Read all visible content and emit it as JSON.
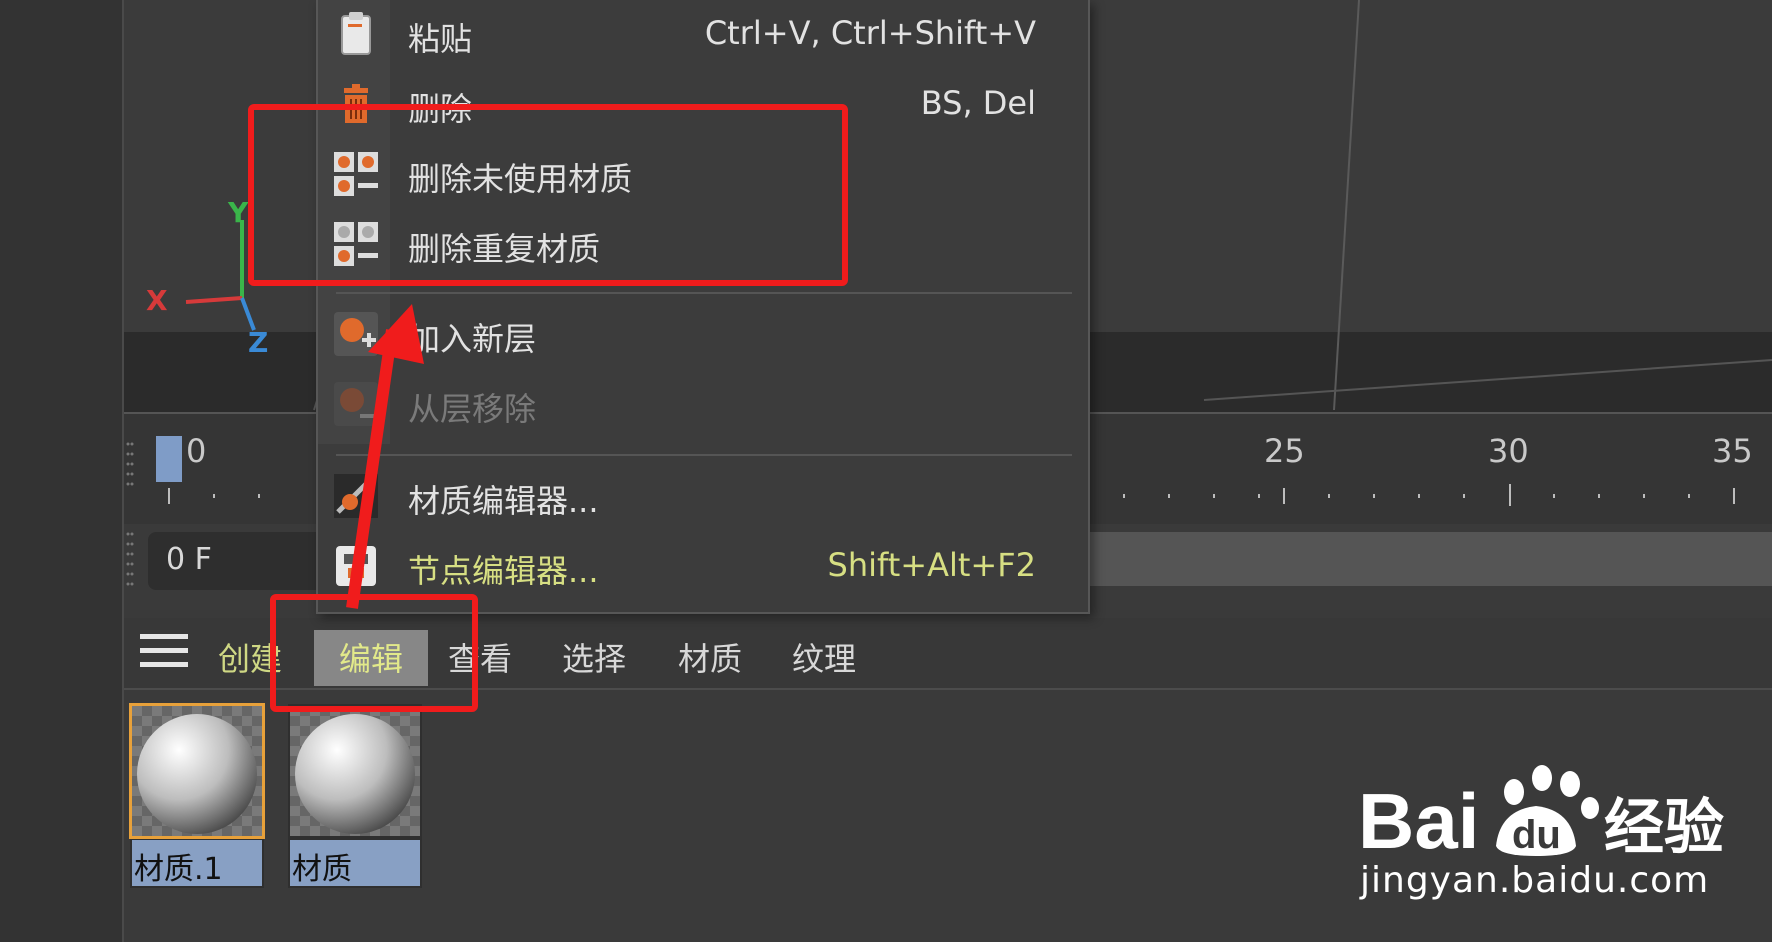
{
  "menu": {
    "items": [
      {
        "label": "粘贴",
        "shortcut": "Ctrl+V, Ctrl+Shift+V",
        "icon": "clipboard-icon"
      },
      {
        "label": "删除",
        "shortcut": "BS, Del",
        "icon": "trash-icon"
      },
      {
        "label": "删除未使用材质",
        "shortcut": "",
        "icon": "delete-unused-materials-icon"
      },
      {
        "label": "删除重复材质",
        "shortcut": "",
        "icon": "delete-duplicate-materials-icon"
      },
      {
        "label": "加入新层",
        "shortcut": "",
        "icon": "add-layer-icon"
      },
      {
        "label": "从层移除",
        "shortcut": "",
        "icon": "remove-from-layer-icon",
        "disabled": true
      },
      {
        "label": "材质编辑器...",
        "shortcut": "",
        "icon": "material-editor-icon"
      },
      {
        "label": "节点编辑器...",
        "shortcut": "Shift+Alt+F2",
        "icon": "node-editor-icon"
      }
    ]
  },
  "viewport": {
    "axes": {
      "x": "X",
      "y": "Y",
      "z": "Z"
    },
    "colors": {
      "x": "#d63a3a",
      "y": "#3ab54a",
      "z": "#3a8ad6"
    }
  },
  "timeline": {
    "ticks": [
      "0",
      "25",
      "30",
      "35"
    ],
    "frame_field": "0 F"
  },
  "material_manager": {
    "tabs": [
      "创建",
      "编辑",
      "查看",
      "选择",
      "材质",
      "纹理"
    ],
    "active_tab": "编辑",
    "materials": [
      {
        "name": "材质.1",
        "selected": true
      },
      {
        "name": "材质",
        "selected": false
      }
    ]
  },
  "watermark": {
    "logo": "Baidu经验",
    "url": "jingyan.baidu.com"
  },
  "annotation_color": "#f01c1c",
  "accent_color": "#d7df83"
}
